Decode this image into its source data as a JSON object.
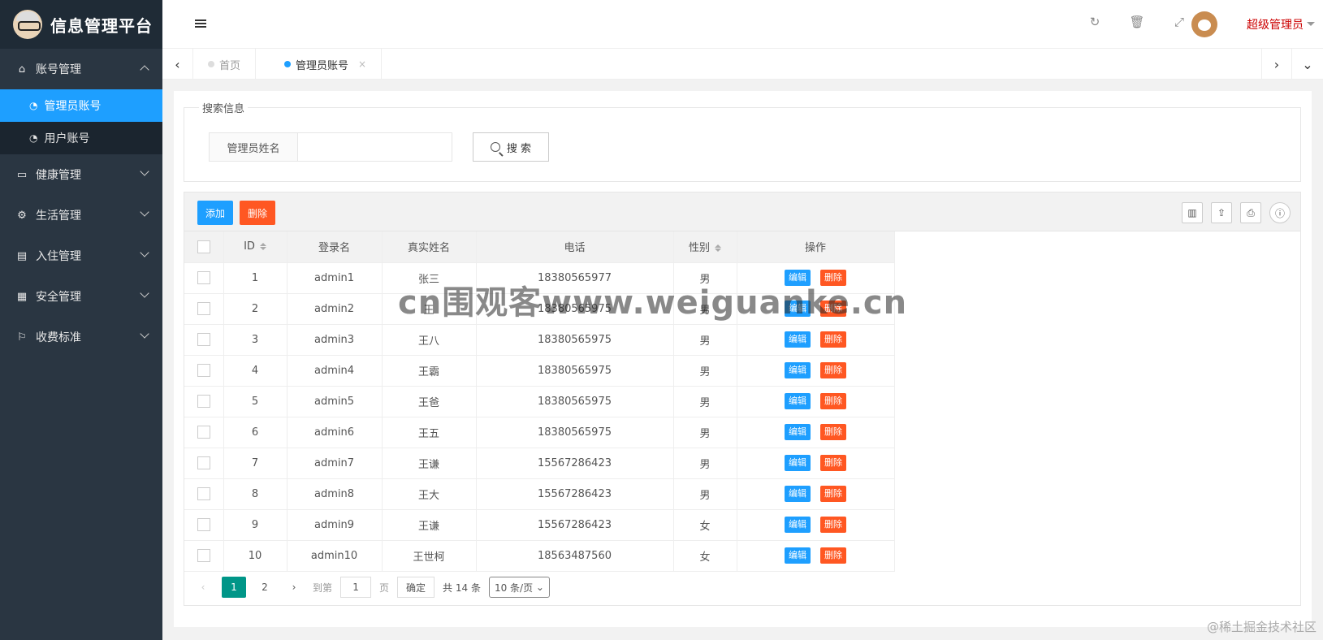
{
  "app": {
    "title": "信息管理平台"
  },
  "sidebar": {
    "groups": [
      {
        "label": "账号管理",
        "icon": "home-icon"
      },
      {
        "label": "健康管理",
        "icon": "window-icon"
      },
      {
        "label": "生活管理",
        "icon": "gears-icon"
      },
      {
        "label": "入住管理",
        "icon": "file-icon"
      },
      {
        "label": "安全管理",
        "icon": "calendar-icon"
      },
      {
        "label": "收费标准",
        "icon": "flag-icon"
      }
    ],
    "subitems": [
      {
        "label": "管理员账号",
        "active": true
      },
      {
        "label": "用户账号",
        "active": false
      }
    ]
  },
  "header": {
    "user": "超级管理员"
  },
  "tabs": [
    {
      "label": "首页"
    },
    {
      "label": "管理员账号",
      "close": "×"
    }
  ],
  "search": {
    "legend": "搜索信息",
    "field_label": "管理员姓名",
    "button": "搜 索"
  },
  "toolbar": {
    "add": "添加",
    "delete": "删除"
  },
  "table": {
    "columns": [
      "ID",
      "登录名",
      "真实姓名",
      "电话",
      "性别",
      "操作"
    ],
    "edit_label": "编辑",
    "delete_label": "删除",
    "rows": [
      {
        "id": "1",
        "login": "admin1",
        "name": "张三",
        "phone": "18380565977",
        "gender": "男"
      },
      {
        "id": "2",
        "login": "admin2",
        "name": "王",
        "phone": "18380565975",
        "gender": "男"
      },
      {
        "id": "3",
        "login": "admin3",
        "name": "王八",
        "phone": "18380565975",
        "gender": "男"
      },
      {
        "id": "4",
        "login": "admin4",
        "name": "王霸",
        "phone": "18380565975",
        "gender": "男"
      },
      {
        "id": "5",
        "login": "admin5",
        "name": "王爸",
        "phone": "18380565975",
        "gender": "男"
      },
      {
        "id": "6",
        "login": "admin6",
        "name": "王五",
        "phone": "18380565975",
        "gender": "男"
      },
      {
        "id": "7",
        "login": "admin7",
        "name": "王谦",
        "phone": "15567286423",
        "gender": "男"
      },
      {
        "id": "8",
        "login": "admin8",
        "name": "王大",
        "phone": "15567286423",
        "gender": "男"
      },
      {
        "id": "9",
        "login": "admin9",
        "name": "王谦",
        "phone": "15567286423",
        "gender": "女"
      },
      {
        "id": "10",
        "login": "admin10",
        "name": "王世柯",
        "phone": "18563487560",
        "gender": "女"
      }
    ]
  },
  "pager": {
    "pages": [
      "1",
      "2"
    ],
    "goto_label": "到第",
    "goto_value": "1",
    "page_unit": "页",
    "confirm": "确定",
    "total": "共 14 条",
    "per_page": "10 条/页"
  },
  "watermark": "cn围观客www.weiguanke.cn",
  "footmark": "@稀土掘金技术社区"
}
